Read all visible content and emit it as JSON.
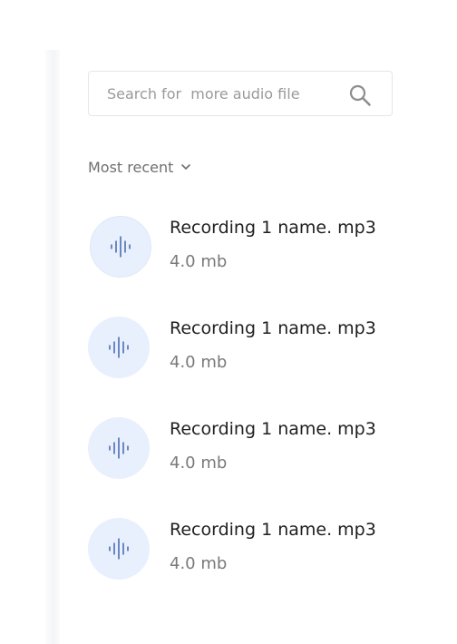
{
  "search": {
    "placeholder": "Search for  more audio file",
    "value": ""
  },
  "sort": {
    "label": "Most recent"
  },
  "recordings": [
    {
      "name": "Recording 1 name. mp3",
      "size": "4.0 mb"
    },
    {
      "name": "Recording 1 name. mp3",
      "size": "4.0 mb"
    },
    {
      "name": "Recording 1 name. mp3",
      "size": "4.0 mb"
    },
    {
      "name": "Recording 1 name. mp3",
      "size": "4.0 mb"
    }
  ],
  "colors": {
    "avatar_bg": "#e8f0fd",
    "wave": "#2b4fa3",
    "text_primary": "#1f1f1f",
    "text_secondary": "#7a7a7a"
  },
  "icons": {
    "search": "search-icon",
    "sort": "chevron-down-icon",
    "file": "audio-waveform-icon"
  }
}
